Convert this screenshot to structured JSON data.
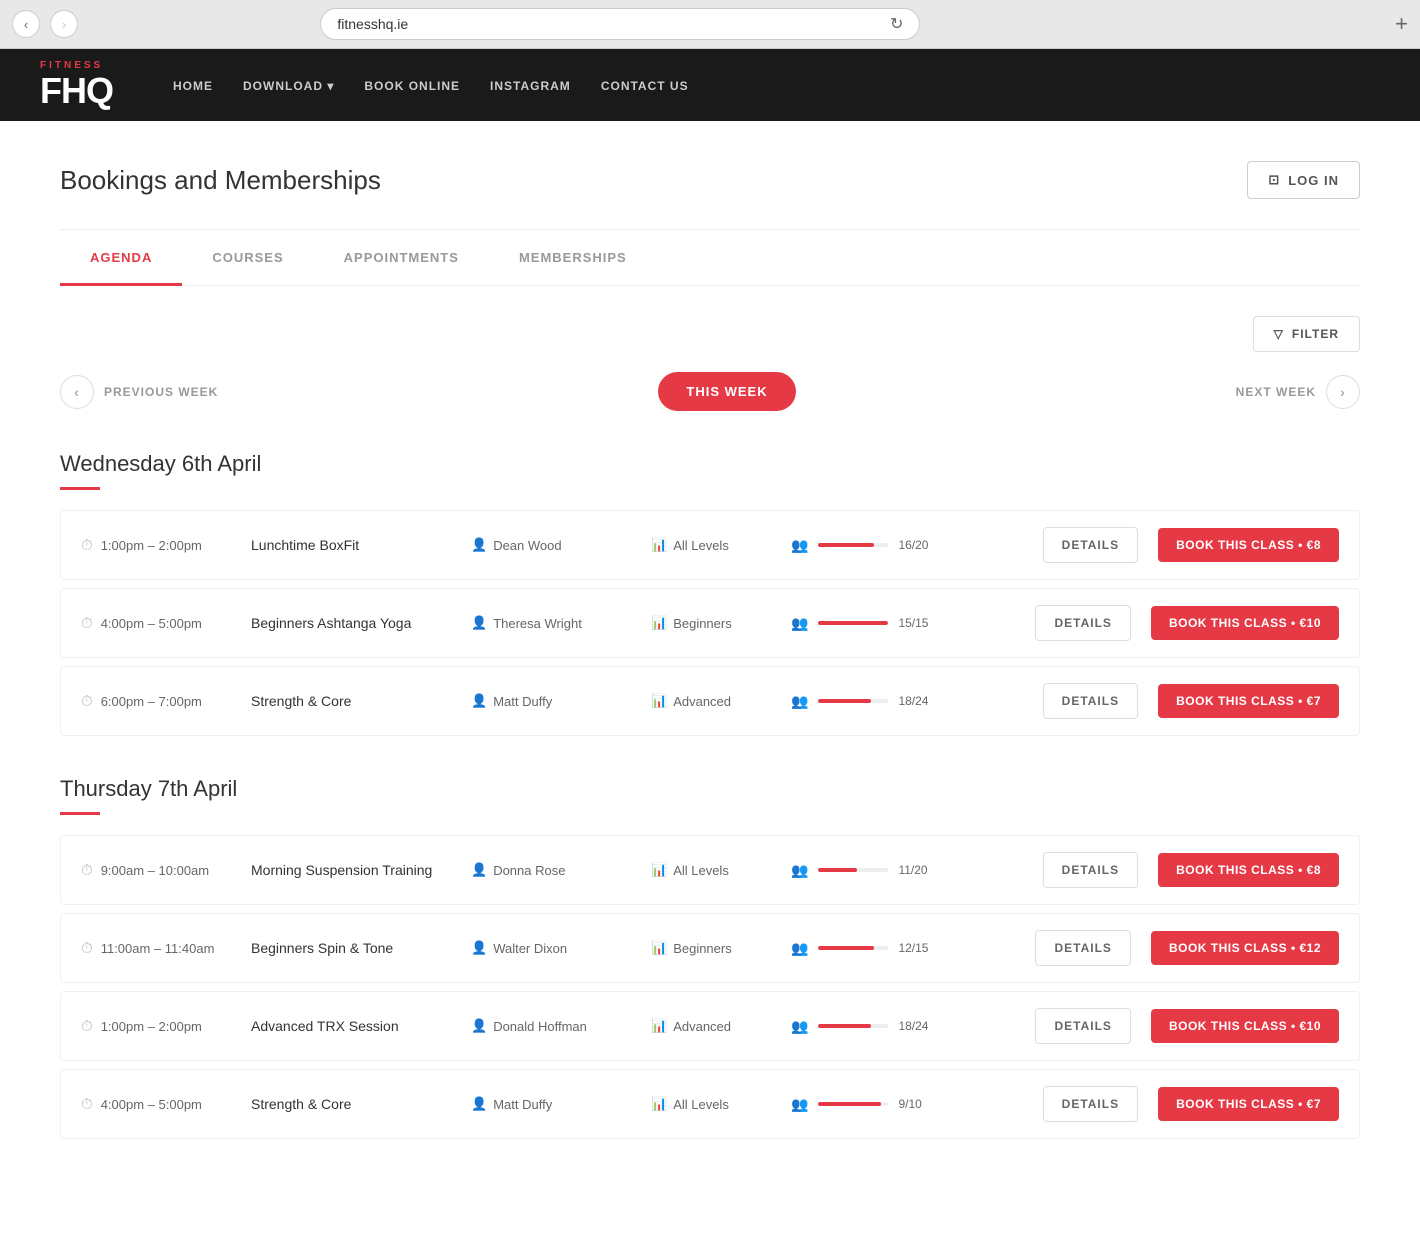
{
  "browser": {
    "url": "fitnesshq.ie",
    "back_disabled": false,
    "forward_disabled": false
  },
  "header": {
    "logo": "FHQ",
    "logo_small": "FITNESS",
    "nav_items": [
      {
        "label": "HOME"
      },
      {
        "label": "DOWNLOAD",
        "has_dropdown": true
      },
      {
        "label": "BOOK ONLINE"
      },
      {
        "label": "INSTAGRAM"
      },
      {
        "label": "CONTACT US"
      }
    ]
  },
  "page": {
    "title": "Bookings and Memberships",
    "login_label": "LOG IN"
  },
  "tabs": [
    {
      "label": "AGENDA",
      "active": true
    },
    {
      "label": "COURSES",
      "active": false
    },
    {
      "label": "APPOINTMENTS",
      "active": false
    },
    {
      "label": "MEMBERSHIPS",
      "active": false
    }
  ],
  "filter": {
    "label": "FILTER"
  },
  "week_nav": {
    "prev_label": "PREVIOUS WEEK",
    "this_week_label": "THIS WEEK",
    "next_label": "NEXT WEEK"
  },
  "days": [
    {
      "title": "Wednesday 6th April",
      "classes": [
        {
          "time": "1:00pm – 2:00pm",
          "name": "Lunchtime BoxFit",
          "trainer": "Dean Wood",
          "level": "All Levels",
          "spots_filled": 16,
          "spots_total": 20,
          "fill_pct": 80,
          "details_label": "DETAILS",
          "book_label": "BOOK THIS CLASS • €8"
        },
        {
          "time": "4:00pm – 5:00pm",
          "name": "Beginners Ashtanga Yoga",
          "trainer": "Theresa Wright",
          "level": "Beginners",
          "spots_filled": 15,
          "spots_total": 15,
          "fill_pct": 100,
          "details_label": "DETAILS",
          "book_label": "BOOK THIS CLASS • €10"
        },
        {
          "time": "6:00pm – 7:00pm",
          "name": "Strength & Core",
          "trainer": "Matt Duffy",
          "level": "Advanced",
          "spots_filled": 18,
          "spots_total": 24,
          "fill_pct": 75,
          "details_label": "DETAILS",
          "book_label": "BOOK THIS CLASS • €7"
        }
      ]
    },
    {
      "title": "Thursday 7th April",
      "classes": [
        {
          "time": "9:00am – 10:00am",
          "name": "Morning Suspension Training",
          "trainer": "Donna Rose",
          "level": "All Levels",
          "spots_filled": 11,
          "spots_total": 20,
          "fill_pct": 55,
          "details_label": "DETAILS",
          "book_label": "BOOK THIS CLASS • €8"
        },
        {
          "time": "11:00am – 11:40am",
          "name": "Beginners Spin & Tone",
          "trainer": "Walter Dixon",
          "level": "Beginners",
          "spots_filled": 12,
          "spots_total": 15,
          "fill_pct": 80,
          "details_label": "DETAILS",
          "book_label": "BOOK THIS CLASS • €12"
        },
        {
          "time": "1:00pm – 2:00pm",
          "name": "Advanced TRX Session",
          "trainer": "Donald Hoffman",
          "level": "Advanced",
          "spots_filled": 18,
          "spots_total": 24,
          "fill_pct": 75,
          "details_label": "DETAILS",
          "book_label": "BOOK THIS CLASS • €10"
        },
        {
          "time": "4:00pm – 5:00pm",
          "name": "Strength & Core",
          "trainer": "Matt Duffy",
          "level": "All Levels",
          "spots_filled": 9,
          "spots_total": 10,
          "fill_pct": 90,
          "details_label": "DETAILS",
          "book_label": "BOOK THIS CLASS • €7"
        }
      ]
    }
  ]
}
